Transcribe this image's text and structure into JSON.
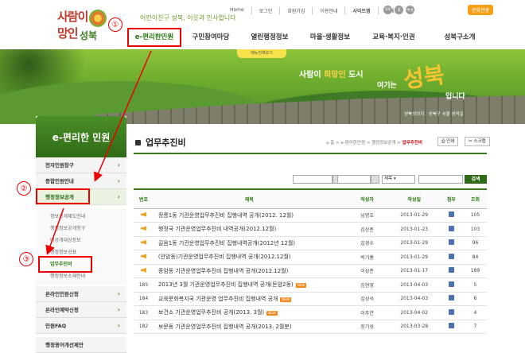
{
  "header": {
    "logo_text_top": "사람이 희망인",
    "logo_text_bottom": "성북",
    "slogan": "어린이친구 성북, 이웃과 인사합니다",
    "top_links": [
      "Home",
      "로그인",
      "회원가입",
      "이용안내",
      "사이트맵",
      "웹메일"
    ],
    "lang_buttons": [
      "EN",
      "日",
      "中文"
    ],
    "culture_button": "문화관광",
    "gnb": [
      "e-편리한민원",
      "구민참여마당",
      "열린행정정보",
      "마을·생활정보",
      "교육·복지·인권",
      "성북구소개"
    ],
    "menu_view": "메뉴전체보기"
  },
  "banner": {
    "line1_a": "사람이 ",
    "line1_hl": "희망인",
    "line1_b": " 도시",
    "line2": "여기는",
    "big": "성북",
    "line3": "입니다",
    "caption": "성북의의지 : 성북구 서울 성곽길"
  },
  "sidebar": {
    "title": "e-편리한 민원",
    "items": [
      {
        "label": "전자민원창구"
      },
      {
        "label": "종합민원안내"
      },
      {
        "label": "행정정보공개"
      },
      {
        "label": "온라인민원신청"
      },
      {
        "label": "온라인예약신청"
      },
      {
        "label": "민원FAQ"
      },
      {
        "label": "행정용어개선제안"
      }
    ],
    "subitems": [
      {
        "label": "정보공개제도안내"
      },
      {
        "label": "행정정보공개청구"
      },
      {
        "label": "비공개대상정보"
      },
      {
        "label": "행정정보공표"
      },
      {
        "label": "업무추진비"
      },
      {
        "label": "행정정보소재안내"
      }
    ]
  },
  "annotations": {
    "n1": "①",
    "n2": "②",
    "n3": "③"
  },
  "content": {
    "title": "업무추진비",
    "breadcrumb": "홈 > e-편리한민원 > 행정정보공개 >",
    "breadcrumb_current": "업무추진비",
    "print_button": "인쇄",
    "scrap_button": "스크랩",
    "search_select": "제목",
    "search_button": "검색",
    "columns": [
      "번호",
      "제목",
      "작성자",
      "작성일",
      "첨부",
      "조회"
    ],
    "rows": [
      {
        "num": "",
        "title": "정릉1동 기관운영업무추진비 집행내역 공개(2012. 12월)",
        "writer": "남명호",
        "date": "2013-01-29",
        "views": "105",
        "new": ""
      },
      {
        "num": "",
        "title": "행정국 기관운영업무추진비 내역공개(2012.12월)",
        "writer": "김상준",
        "date": "2013-01-23",
        "views": "103",
        "new": ""
      },
      {
        "num": "",
        "title": "길음1동 기관운영업무추진비 집행내역공개(2012년 12월)",
        "writer": "김경수",
        "date": "2013-01-29",
        "views": "96",
        "new": ""
      },
      {
        "num": "",
        "title": "(안암동)기관운영업무추진비 집행내역 공개(2012.12월)",
        "writer": "박기홍",
        "date": "2013-01-29",
        "views": "84",
        "new": ""
      },
      {
        "num": "",
        "title": "종암동 기관운영업무추진비 집행내역 공개(2012.12월)",
        "writer": "이성준",
        "date": "2013-01-17",
        "views": "189",
        "new": ""
      },
      {
        "num": "185",
        "title": "2013년 3월 기관운영업무추진비 집행내역 공개(돈암2동)",
        "writer": "김현영",
        "date": "2013-04-03",
        "views": "5",
        "new": "NEW"
      },
      {
        "num": "184",
        "title": "교육문화복지국 기관운영 업무추진비 집행내역 공개",
        "writer": "김성석",
        "date": "2013-04-03",
        "views": "6",
        "new": "NEW"
      },
      {
        "num": "183",
        "title": "보건소 기관운영업무추진비 공개(2013. 3월)",
        "writer": "이주연",
        "date": "2013-04-02",
        "views": "4",
        "new": "NEW"
      },
      {
        "num": "182",
        "title": "보문동 기관운영업무추진비 집행내역 공개(2013. 2월분)",
        "writer": "장기성",
        "date": "2013-03-28",
        "views": "7",
        "new": ""
      }
    ]
  }
}
